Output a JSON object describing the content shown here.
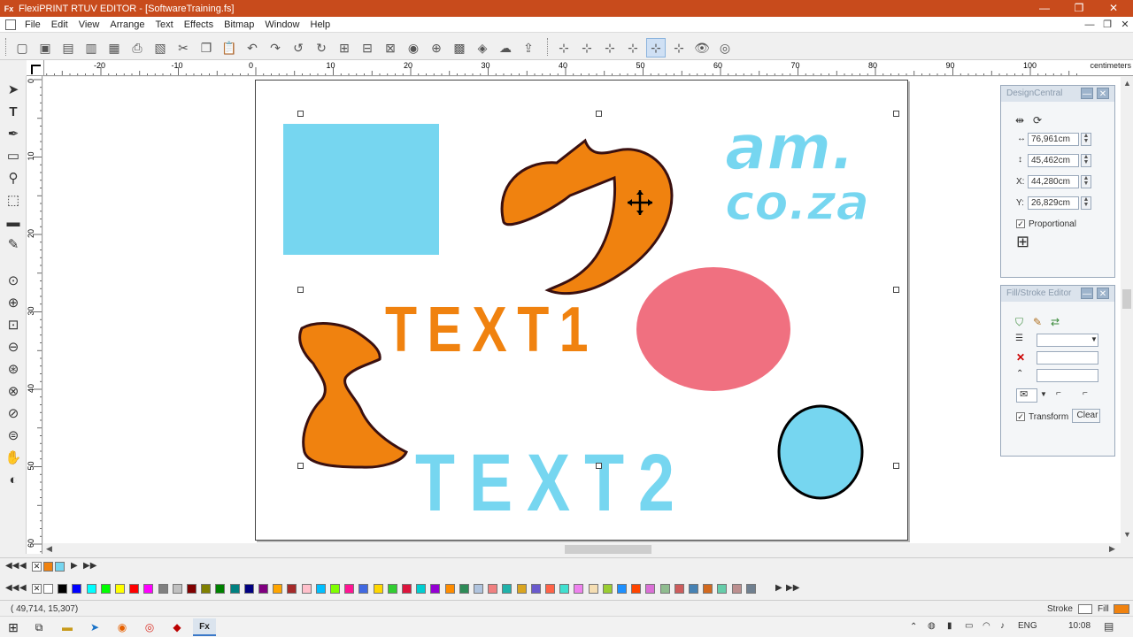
{
  "window": {
    "app_icon": "Fx",
    "title": "FlexiPRINT RTUV EDITOR - [SoftwareTraining.fs]",
    "minimize": "—",
    "maximize": "❐",
    "close": "✕"
  },
  "menu": {
    "items": [
      "File",
      "Edit",
      "View",
      "Arrange",
      "Text",
      "Effects",
      "Bitmap",
      "Window",
      "Help"
    ],
    "doc_minimize": "—",
    "doc_restore": "❐",
    "doc_close": "✕"
  },
  "ruler": {
    "unit": "centimeters",
    "top_ticks": [
      "-20",
      "-10",
      "0",
      "10",
      "20",
      "30",
      "40",
      "50",
      "60",
      "70",
      "80",
      "90",
      "100"
    ],
    "left_ticks": [
      "0",
      "10",
      "20",
      "30",
      "40",
      "50",
      "60"
    ]
  },
  "canvas": {
    "text1": "TEXT1",
    "text2": "TEXT2",
    "logo_line1": "am.",
    "logo_line2": "co.za"
  },
  "design_central": {
    "title": "DesignCentral",
    "width": "76,961cm",
    "height": "45,462cm",
    "x_label": "X:",
    "x": "44,280cm",
    "y_label": "Y:",
    "y": "26,829cm",
    "proportional": "Proportional"
  },
  "fill_stroke": {
    "title": "Fill/Stroke Editor",
    "transform": "Transform",
    "clear": "Clear"
  },
  "status": {
    "coords": "( 49,714, 15,307)",
    "stroke_label": "Stroke",
    "fill_label": "Fill"
  },
  "taskbar": {
    "language": "ENG",
    "time": "10:08",
    "active_app": "Fx"
  },
  "colors": {
    "titlebar": "#c84b1c",
    "orange": "#f0820f",
    "light_blue": "#76d6f0",
    "pink": "#f07080",
    "outline": "#3a1010"
  },
  "palette": [
    "#ffffff",
    "#000000",
    "#0000ff",
    "#00ffff",
    "#00ff00",
    "#ffff00",
    "#ff0000",
    "#ff00ff",
    "#808080",
    "#c0c0c0",
    "#800000",
    "#808000",
    "#008000",
    "#008080",
    "#000080",
    "#800080",
    "#ffa500",
    "#a52a2a",
    "#ffc0cb",
    "#00bfff",
    "#7fff00",
    "#ff1493",
    "#4169e1",
    "#ffd700",
    "#32cd32",
    "#dc143c",
    "#00ced1",
    "#9400d3",
    "#ff8c00",
    "#2e8b57",
    "#b0c4de",
    "#f08080",
    "#20b2aa",
    "#daa520",
    "#6a5acd",
    "#ff6347",
    "#40e0d0",
    "#ee82ee",
    "#f5deb3",
    "#9acd32",
    "#1e90ff",
    "#ff4500",
    "#da70d6",
    "#8fbc8f",
    "#cd5c5c",
    "#4682b4",
    "#d2691e",
    "#66cdaa",
    "#bc8f8f",
    "#708090"
  ]
}
